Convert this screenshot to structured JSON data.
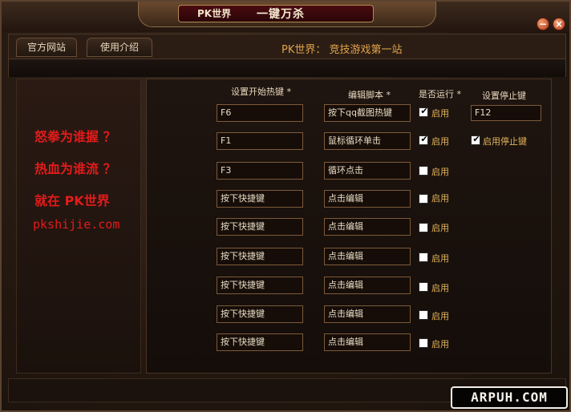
{
  "window": {
    "brand_small": "PK世界",
    "title": "一键万杀",
    "minimize_label": "−",
    "close_label": "×"
  },
  "tabs": [
    {
      "label": "官方网站"
    },
    {
      "label": "使用介绍"
    }
  ],
  "banner": "PK世界：  竞技游戏第一站",
  "left_panel": {
    "slogans": [
      "怒拳为谁握 ？",
      "热血为谁流 ？",
      "就在 PK世界"
    ],
    "url": "pkshijie.com"
  },
  "columns": {
    "hotkey": "设置开始热键 *",
    "script": "编辑脚本 *",
    "run": "是否运行 *",
    "stop": "设置停止键"
  },
  "rows": [
    {
      "hotkey": "F6",
      "script": "按下qq截图热键",
      "checked": true,
      "enable_label": "启用"
    },
    {
      "hotkey": "F1",
      "script": "鼠标循环单击",
      "checked": true,
      "enable_label": "启用"
    },
    {
      "hotkey": "F3",
      "script": "循环点击",
      "checked": false,
      "enable_label": "启用"
    },
    {
      "hotkey": "按下快捷键",
      "script": "点击编辑",
      "checked": false,
      "enable_label": "启用"
    },
    {
      "hotkey": "按下快捷键",
      "script": "点击编辑",
      "checked": false,
      "enable_label": "启用"
    },
    {
      "hotkey": "按下快捷键",
      "script": "点击编辑",
      "checked": false,
      "enable_label": "启用"
    },
    {
      "hotkey": "按下快捷键",
      "script": "点击编辑",
      "checked": false,
      "enable_label": "启用"
    },
    {
      "hotkey": "按下快捷键",
      "script": "点击编辑",
      "checked": false,
      "enable_label": "启用"
    },
    {
      "hotkey": "按下快捷键",
      "script": "点击编辑",
      "checked": false,
      "enable_label": "启用"
    }
  ],
  "stop": {
    "key": "F12",
    "enabled": true,
    "enable_label": "启用停止键"
  },
  "watermark": "ARPUH.COM",
  "colors": {
    "slogan_red": "#e31b1b",
    "label_gold": "#e3b45b",
    "banner_gold": "#e0a44b"
  }
}
